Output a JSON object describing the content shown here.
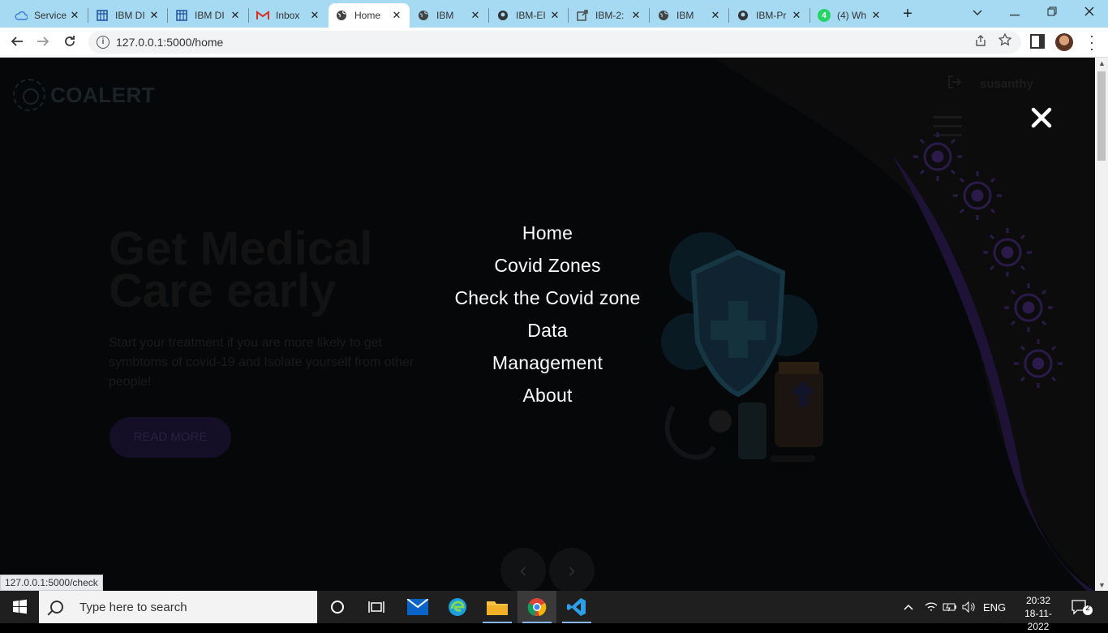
{
  "browser": {
    "tabs": [
      {
        "label": "Service",
        "icon": "cloud-icon"
      },
      {
        "label": "IBM DI",
        "icon": "grid-icon"
      },
      {
        "label": "IBM DI",
        "icon": "grid-icon"
      },
      {
        "label": "Inbox",
        "icon": "gmail-icon"
      },
      {
        "label": "Home",
        "icon": "globe-icon",
        "active": true
      },
      {
        "label": "IBM",
        "icon": "globe-icon"
      },
      {
        "label": "IBM-EI",
        "icon": "github-icon"
      },
      {
        "label": "IBM-2:",
        "icon": "external-icon"
      },
      {
        "label": "IBM",
        "icon": "globe-icon"
      },
      {
        "label": "IBM-Pr",
        "icon": "github-icon"
      },
      {
        "label": "(4) Wh",
        "icon": "whatsapp-icon"
      }
    ],
    "tab_close_glyph": "✕",
    "new_tab_glyph": "+",
    "url": "127.0.0.1:5000/home",
    "status_hover_url": "127.0.0.1:5000/check",
    "whatsapp_badge": "4"
  },
  "site": {
    "brand": "COALERT",
    "username": "susanthy",
    "hero_title": "Get Medical Care early",
    "hero_text": "Start your treatment if you are more likely to get symbtoms of covid-19 and Isolate yourself from other people!",
    "read_more": "READ MORE",
    "overlay_menu": [
      "Home",
      "Covid Zones",
      "Check the Covid zone",
      "Data",
      "Management",
      "About"
    ],
    "close_glyph": "✕",
    "prev_glyph": "‹",
    "next_glyph": "›"
  },
  "taskbar": {
    "search_placeholder": "Type here to search",
    "language": "ENG",
    "time": "20:32",
    "date": "18-11-2022",
    "notification_count": "2"
  },
  "colors": {
    "tabbar_bg": "#a6daf2",
    "overlay_text": "#ffffff",
    "virus_purple": "#2b1a4a",
    "page_curve_purple": "#2a1a52"
  }
}
